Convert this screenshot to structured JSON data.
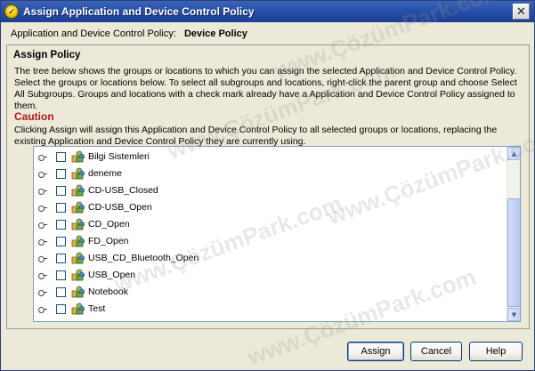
{
  "window": {
    "title": "Assign Application and Device Control Policy",
    "close_glyph": "✕"
  },
  "policy": {
    "label": "Application and Device Control Policy:",
    "value": "Device Policy"
  },
  "assign_policy": {
    "heading": "Assign Policy",
    "description": "The tree below shows the groups or locations to which you can assign the selected Application and Device Control Policy. Select the groups or locations below. To select all subgroups and locations, right-click the parent group and choose Select All Subgroups. Groups and locations with a check mark already have a Application and Device Control Policy assigned to them."
  },
  "caution": {
    "heading": "Caution",
    "text": "Clicking Assign will assign this Application and Device Control Policy to all selected groups or locations, replacing the existing Application and Device Control Policy they are currently using."
  },
  "tree": {
    "items": [
      {
        "label": "Bilgi Sistemleri",
        "checked": false
      },
      {
        "label": "deneme",
        "checked": false
      },
      {
        "label": "CD-USB_Closed",
        "checked": false
      },
      {
        "label": "CD-USB_Open",
        "checked": false
      },
      {
        "label": "CD_Open",
        "checked": false
      },
      {
        "label": "FD_Open",
        "checked": false
      },
      {
        "label": "USB_CD_Bluetooth_Open",
        "checked": false
      },
      {
        "label": "USB_Open",
        "checked": false
      },
      {
        "label": "Notebook",
        "checked": false
      },
      {
        "label": "Test",
        "checked": false
      }
    ]
  },
  "buttons": {
    "assign": "Assign",
    "cancel": "Cancel",
    "help": "Help"
  },
  "watermark": "www.ÇözümPark.com",
  "colors": {
    "titlebar": "#2850a8",
    "caution": "#b01818",
    "dialog_bg": "#ece9d8"
  }
}
